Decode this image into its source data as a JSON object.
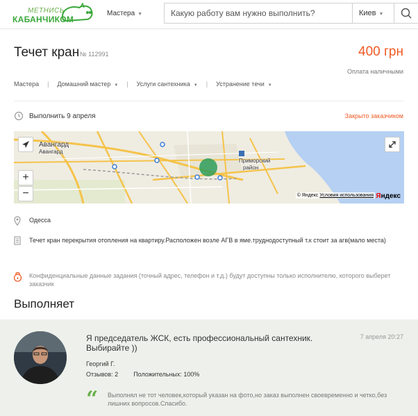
{
  "header": {
    "logo_line1": "МЕТНИСЬ",
    "logo_line2": "КАБАНЧИКОМ",
    "nav_masters": "Мастера",
    "search_placeholder": "Какую работу вам нужно выполнить?",
    "city": "Киев",
    "search_icon": "search-icon"
  },
  "task": {
    "title": "Течет кран",
    "number": "№ 112991",
    "price": "400 грн",
    "payment": "Оплата наличными",
    "price_color": "#f05a24"
  },
  "breadcrumb": [
    "Мастера",
    "Домашний мастер",
    "Услуги сантехника",
    "Устранение течи"
  ],
  "date_row": {
    "date_text": "Выполнить 9 апреля",
    "status": "Закрыто заказчиком",
    "icon": "clock-icon"
  },
  "map": {
    "label_avangard_1": "Авангард",
    "label_avangard_2": "Авангард",
    "label_district_1": "Приморский",
    "label_district_2": "район",
    "copyright": "© Яндекс",
    "terms": "Условия использования",
    "brand_first": "Я",
    "brand_rest": "ндекс",
    "zoom_in": "+",
    "zoom_out": "−"
  },
  "location": {
    "city": "Одесса",
    "icon": "map-pin-icon"
  },
  "description": {
    "text": "Течет кран перекрытия отопления на квартиру.Расположен возле АГВ в яме.труднодоступный т.к стоит за агв(мало места)",
    "icon": "document-icon"
  },
  "privacy": {
    "text": "Конфиденциальные данные задания (точный адрес, телефон и т.д.) будут доступны только исполнителю, которого выберет заказчик",
    "icon": "lock-icon"
  },
  "executor": {
    "heading": "Выполняет",
    "quote": "Я председатель ЖСК, есть профессиональный сантехник. Выбирайте ))",
    "date": "7 апреля 20:27",
    "name": "Георгий Г.",
    "reviews": "Отзывов: 2",
    "positive": "Положительных: 100%",
    "review_text": "Выполнял не тот человек,который указан на фото,но заказ выполнен своевременно и четко,без лишних вопросов.Спасибо.",
    "accent": "#6ab04c"
  }
}
